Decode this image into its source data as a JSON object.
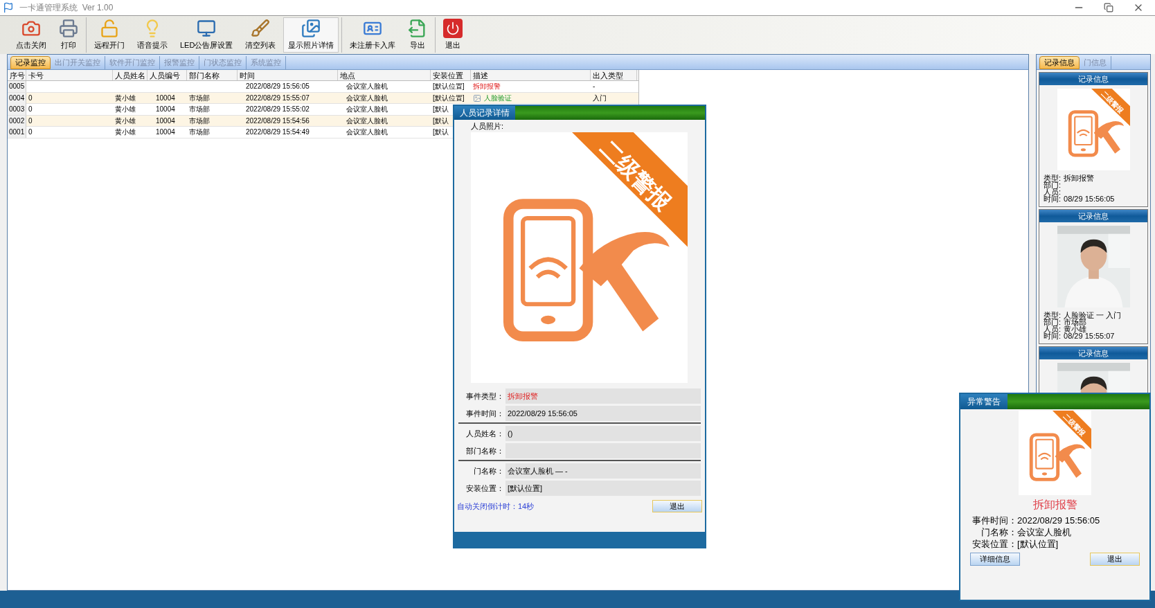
{
  "window": {
    "title": "一卡通管理系统  Ver 1.00"
  },
  "toolbar": [
    [
      {
        "label": "点击关闭",
        "selected": false
      },
      {
        "label": "打印",
        "selected": false
      }
    ],
    [
      {
        "label": "远程开门",
        "selected": false
      },
      {
        "label": "语音提示",
        "selected": false
      },
      {
        "label": "LED公告屏设置",
        "selected": false
      },
      {
        "label": "清空列表",
        "selected": false
      },
      {
        "label": "显示照片详情",
        "selected": true
      }
    ],
    [
      {
        "label": "未注册卡入库",
        "selected": false
      },
      {
        "label": "导出",
        "selected": false
      }
    ],
    [
      {
        "label": "退出",
        "selected": false
      }
    ]
  ],
  "main_tabs": [
    {
      "label": "记录监控",
      "selected": true
    },
    {
      "label": "出门开关监控",
      "selected": false
    },
    {
      "label": "软件开门监控",
      "selected": false
    },
    {
      "label": "报警监控",
      "selected": false
    },
    {
      "label": "门状态监控",
      "selected": false
    },
    {
      "label": "系统监控",
      "selected": false
    }
  ],
  "table": {
    "columns": [
      "序号",
      "卡号",
      "人员姓名",
      "人员编号",
      "部门名称",
      "时间",
      "地点",
      "安装位置",
      "描述",
      "出入类型"
    ],
    "rows": [
      {
        "no": "0005",
        "card": "",
        "name": "",
        "id": "",
        "dept": "",
        "time": "2022/08/29 15:56:05",
        "place": "会议室人脸机",
        "position": "[默认位置]",
        "desc": "拆卸报警",
        "kind": "alarm",
        "direction": "-"
      },
      {
        "no": "0004",
        "card": "0",
        "name": "黄小雄",
        "id": "10004",
        "dept": "市场部",
        "time": "2022/08/29 15:55:07",
        "place": "会议室人脸机",
        "position": "[默认位置]",
        "desc": "人脸验证",
        "kind": "verify",
        "direction": "入门"
      },
      {
        "no": "0003",
        "card": "0",
        "name": "黄小雄",
        "id": "10004",
        "dept": "市场部",
        "time": "2022/08/29 15:55:02",
        "place": "会议室人脸机",
        "position": "[默认"
      },
      {
        "no": "0002",
        "card": "0",
        "name": "黄小雄",
        "id": "10004",
        "dept": "市场部",
        "time": "2022/08/29 15:54:56",
        "place": "会议室人脸机",
        "position": "[默认"
      },
      {
        "no": "0001",
        "card": "0",
        "name": "黄小雄",
        "id": "10004",
        "dept": "市场部",
        "time": "2022/08/29 15:54:49",
        "place": "会议室人脸机",
        "position": "[默认"
      }
    ]
  },
  "side_tabs": [
    {
      "label": "记录信息",
      "selected": true
    },
    {
      "label": "门信息",
      "selected": false
    }
  ],
  "side_cards": [
    {
      "title": "记录信息",
      "image": {
        "kind": "alarm",
        "ribbon": "二级警报"
      },
      "lines": [
        {
          "label": "类型:",
          "value": "拆卸报警"
        },
        {
          "label": "部门:"
        },
        {
          "label": "人员:"
        },
        {
          "label": "时间:",
          "value": "08/29 15:56:05"
        }
      ]
    },
    {
      "title": "记录信息",
      "image": {
        "kind": "picture"
      },
      "lines": [
        {
          "label": "类型:",
          "value": "人脸验证 一 入门"
        },
        {
          "label": "部门:",
          "value": "市场部"
        },
        {
          "label": "人员:",
          "value": "黄小雄"
        },
        {
          "label": "时间:",
          "value": "08/29 15:55:07"
        }
      ]
    },
    {
      "title": "记录信息",
      "image": {
        "kind": "picture"
      }
    }
  ],
  "detail_dialog": {
    "title": "人员记录详情",
    "photo_label": "人员照片:",
    "image": {
      "kind": "alarm",
      "ribbon": "二级警报"
    },
    "field_groups": [
      [
        {
          "label": "事件类型：",
          "value": "拆卸报警",
          "alert": true
        },
        {
          "label": "事件时间：",
          "value": "2022/08/29 15:56:05",
          "alert": false
        }
      ],
      [
        {
          "label": "人员姓名：",
          "value": "()",
          "alert": false
        },
        {
          "label": "部门名称："
        }
      ],
      [
        {
          "label": "门名称：",
          "value": "会议室人脸机 — -",
          "alert": false
        },
        {
          "label": "安装位置：",
          "value": "[默认位置]",
          "alert": false
        }
      ]
    ],
    "countdown": "自动关闭倒计时：14秒",
    "button": {
      "label": "退出",
      "focused": true
    }
  },
  "alert_popup": {
    "title": "异常警告",
    "image": {
      "kind": "alarm",
      "ribbon": "二级警报"
    },
    "event": "拆卸报警",
    "lines": [
      {
        "label": "事件时间：",
        "value": "2022/08/29 15:56:05"
      },
      {
        "label": "门名称：",
        "value": "会议室人脸机"
      },
      {
        "label": "安装位置：",
        "value": "[默认位置]"
      }
    ],
    "buttons": [
      {
        "label": "详细信息",
        "focused": false
      },
      {
        "label": "退出",
        "focused": true
      }
    ]
  }
}
